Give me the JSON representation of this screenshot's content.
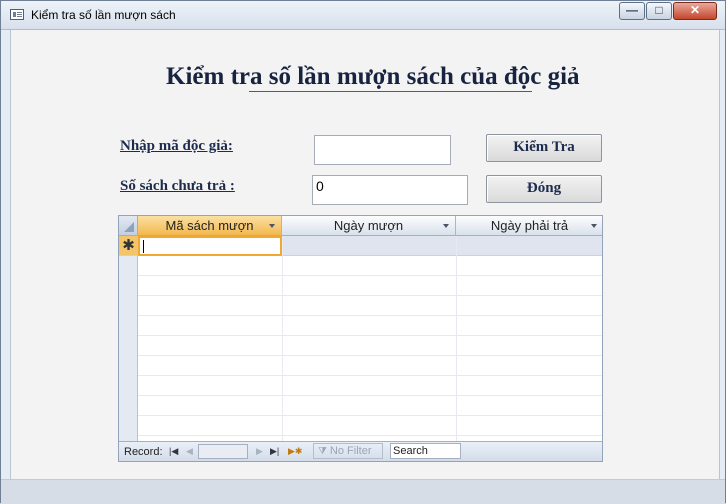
{
  "window": {
    "title": "Kiểm tra số lần mượn sách",
    "min_glyph": "—",
    "max_glyph": "□",
    "close_glyph": "✕"
  },
  "form": {
    "heading": "Kiểm tra số lần mượn sách của độc giả",
    "reader_id_label": "Nhập mã độc giả:",
    "reader_id_value": "",
    "unreturned_label": "Số sách chưa trả :",
    "unreturned_value": "0",
    "check_button": "Kiểm Tra",
    "close_button": "Đóng"
  },
  "datasheet": {
    "columns": [
      "Mã sách mượn",
      "Ngày mượn",
      "Ngày phải trả"
    ],
    "new_record_marker": "✱",
    "rows": []
  },
  "navigation": {
    "record_label": "Record:",
    "first_icon": "first-record-icon",
    "prev_icon": "previous-record-icon",
    "next_icon": "next-record-icon",
    "last_icon": "last-record-icon",
    "new_icon": "new-record-icon",
    "filter_label": "No Filter",
    "search_label": "Search"
  }
}
